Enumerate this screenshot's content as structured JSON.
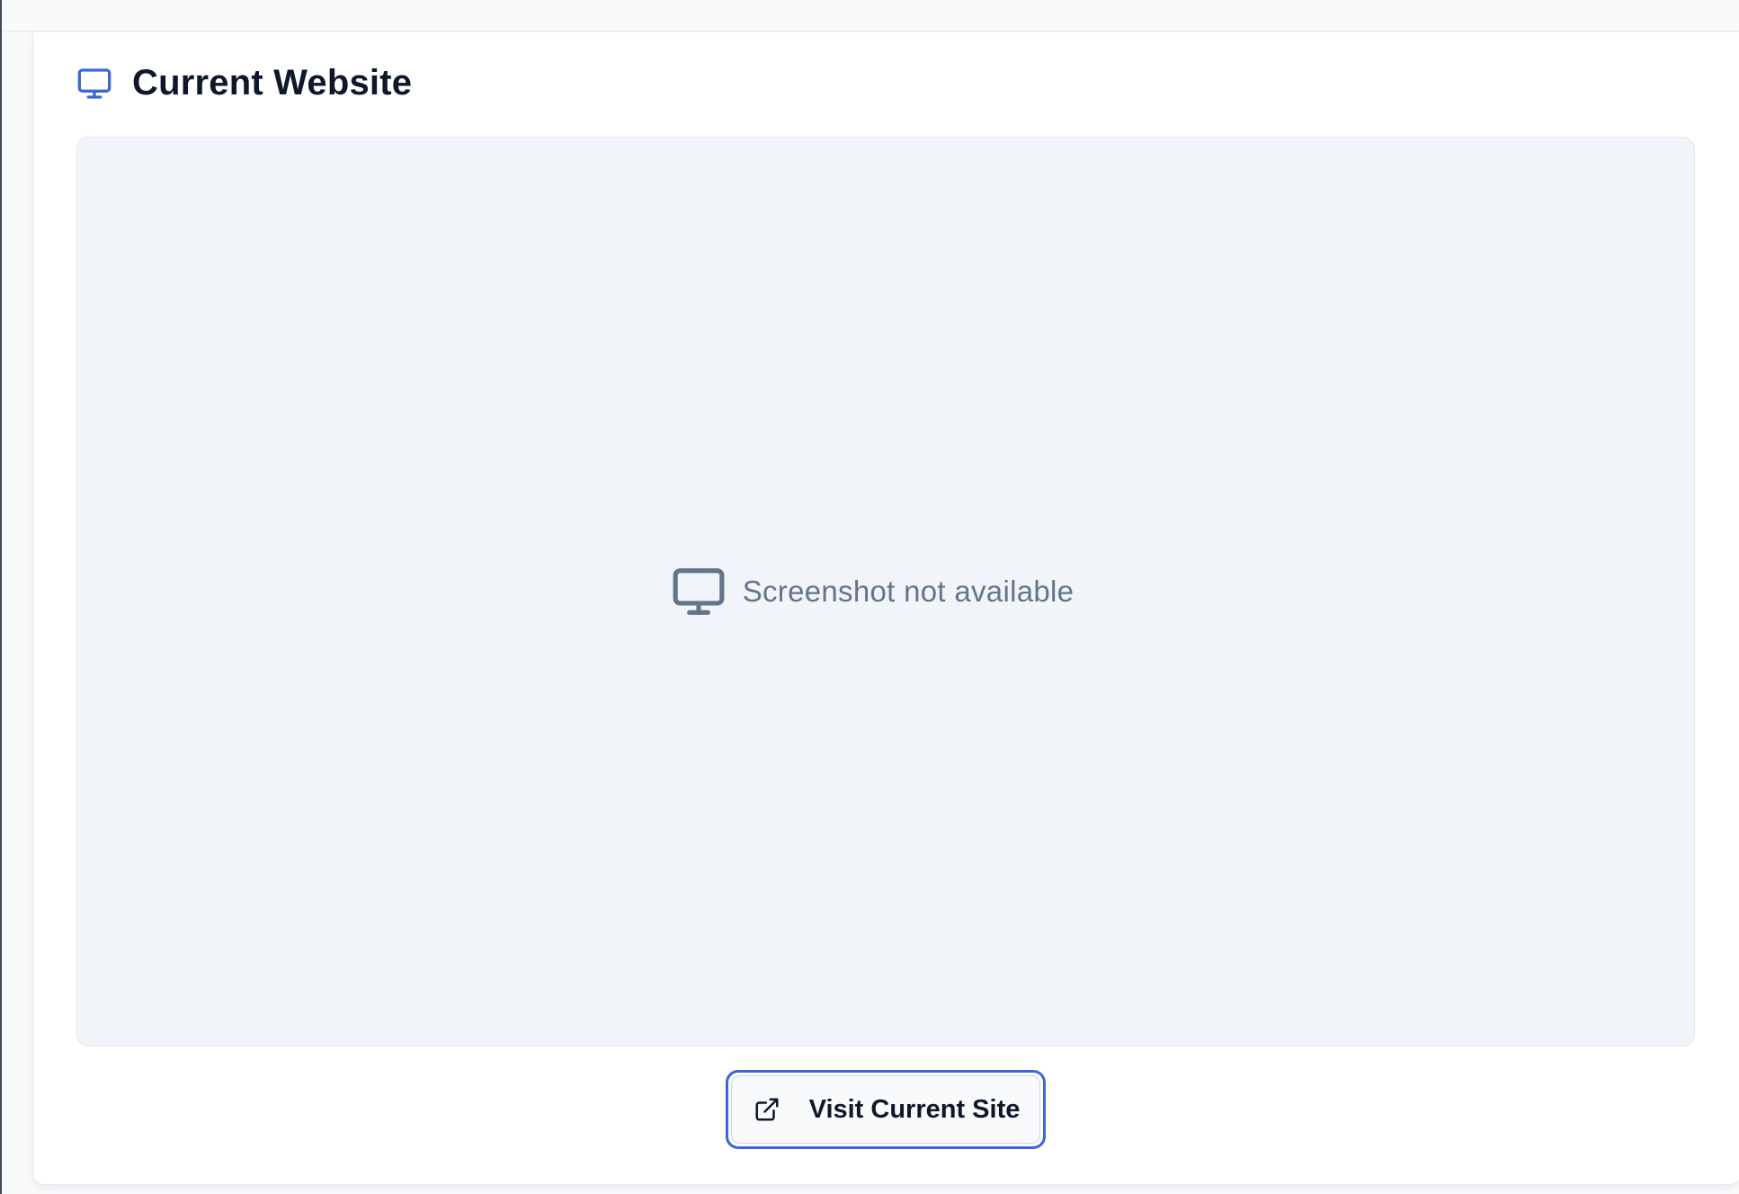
{
  "card": {
    "title": "Current Website",
    "title_icon": "monitor-icon"
  },
  "preview": {
    "placeholder_icon": "monitor-icon",
    "placeholder_text": "Screenshot not available"
  },
  "actions": {
    "visit_label": "Visit Current Site",
    "visit_icon": "external-link-icon"
  },
  "colors": {
    "accent": "#3b66d9",
    "title_text": "#0f172a",
    "muted_text": "#64748b",
    "preview_bg": "#f1f5f9"
  }
}
